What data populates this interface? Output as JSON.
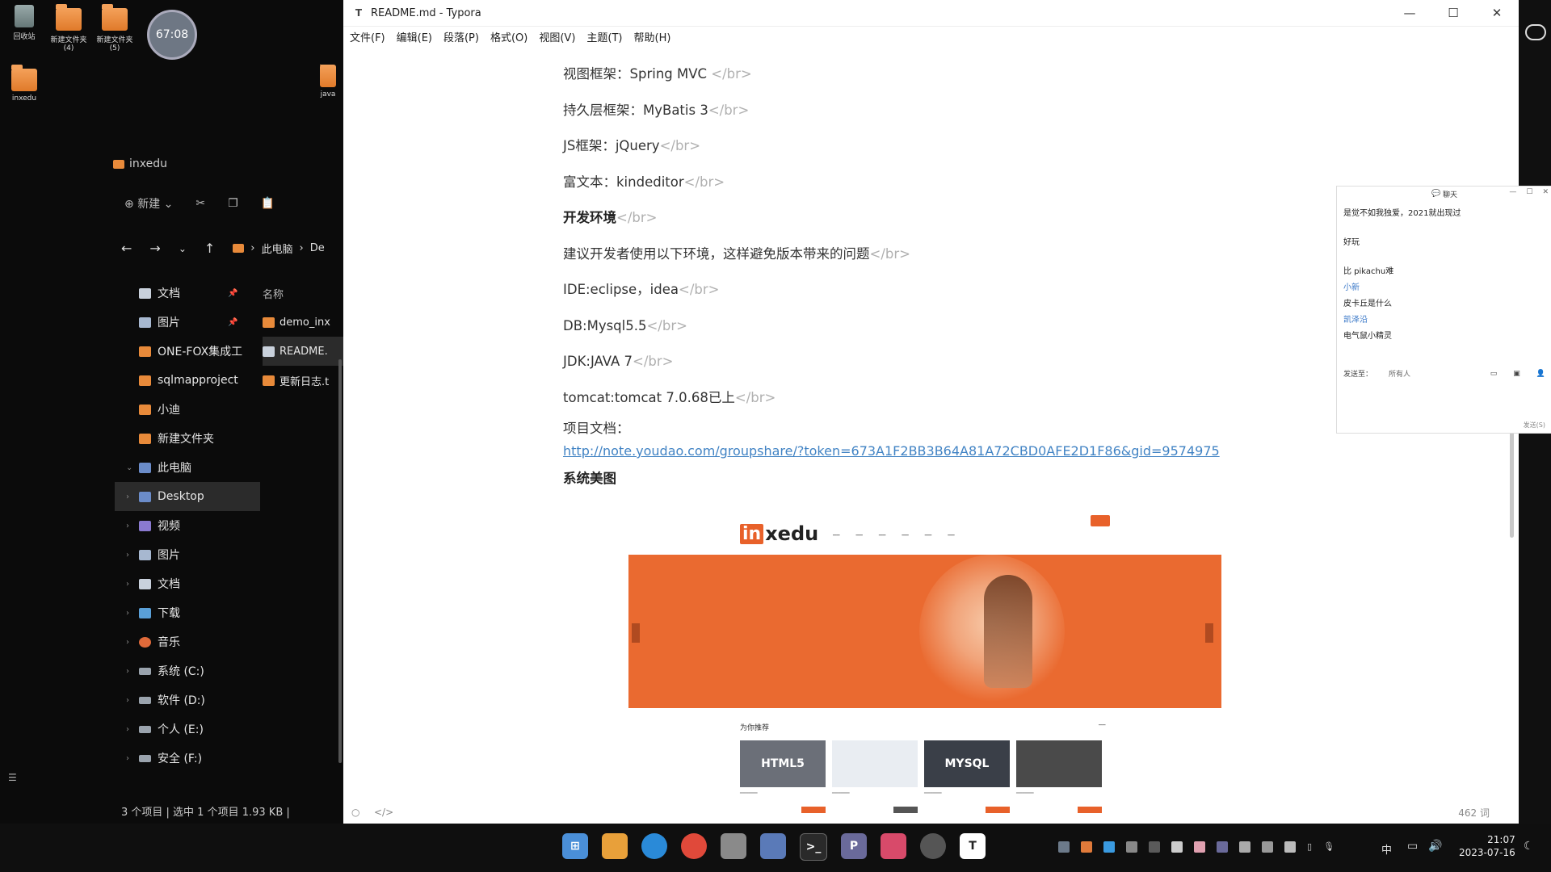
{
  "desktop": {
    "icons": [
      {
        "label": "回收站",
        "kind": "recycle"
      },
      {
        "label": "新建文件夹 (4)",
        "kind": "folder"
      },
      {
        "label": "新建文件夹 (5)",
        "kind": "folder"
      },
      {
        "label": "inxedu",
        "kind": "folder"
      },
      {
        "label": "java",
        "kind": "folder"
      }
    ],
    "timer": "67:08"
  },
  "explorer": {
    "folder_title": "inxedu",
    "toolbar": {
      "new_label": "新建"
    },
    "breadcrumb": [
      "此电脑",
      "De"
    ],
    "quick_access": [
      {
        "label": "文档",
        "icon": "doc-icon",
        "pinned": true
      },
      {
        "label": "图片",
        "icon": "picture-icon",
        "pinned": true
      },
      {
        "label": "ONE-FOX集成工",
        "icon": "folder-icon"
      },
      {
        "label": "sqlmapproject",
        "icon": "folder-icon"
      },
      {
        "label": "小迪",
        "icon": "folder-icon"
      },
      {
        "label": "新建文件夹",
        "icon": "folder-icon"
      }
    ],
    "this_pc_label": "此电脑",
    "this_pc_items": [
      {
        "label": "Desktop",
        "icon": "desktop-icon",
        "selected": true
      },
      {
        "label": "视频",
        "icon": "video-icon"
      },
      {
        "label": "图片",
        "icon": "picture-icon"
      },
      {
        "label": "文档",
        "icon": "doc-icon"
      },
      {
        "label": "下载",
        "icon": "download-icon"
      },
      {
        "label": "音乐",
        "icon": "music-icon"
      },
      {
        "label": "系统 (C:)",
        "icon": "drive-icon"
      },
      {
        "label": "软件 (D:)",
        "icon": "drive-icon"
      },
      {
        "label": "个人 (E:)",
        "icon": "drive-icon"
      },
      {
        "label": "安全 (F:)",
        "icon": "drive-icon"
      }
    ],
    "files_header": "名称",
    "files": [
      {
        "name": "demo_inx",
        "icon": "folder-icon"
      },
      {
        "name": "README.",
        "icon": "md-file-icon",
        "selected": true
      },
      {
        "name": "更新日志.t",
        "icon": "txt-file-icon"
      }
    ],
    "status": "3 个项目  |  选中 1 个项目  1.93 KB  |"
  },
  "typora": {
    "title": "README.md - Typora",
    "menu": [
      "文件(F)",
      "编辑(E)",
      "段落(P)",
      "格式(O)",
      "视图(V)",
      "主题(T)",
      "帮助(H)"
    ],
    "lines": [
      {
        "text": "视图框架：Spring MVC ",
        "tag": "</br>",
        "bold": false
      },
      {
        "text": "持久层框架：MyBatis 3",
        "tag": "</br>",
        "bold": false
      },
      {
        "text": "JS框架：jQuery",
        "tag": "</br>",
        "bold": false
      },
      {
        "text": "富文本：kindeditor",
        "tag": "</br>",
        "bold": false
      },
      {
        "text": "开发环境",
        "tag": "</br>",
        "bold": true
      },
      {
        "text": "建议开发者使用以下环境，这样避免版本带来的问题",
        "tag": "</br>",
        "bold": false
      },
      {
        "text": "IDE:eclipse，idea",
        "tag": "</br>",
        "bold": false
      },
      {
        "text": "DB:Mysql5.5",
        "tag": "</br>",
        "bold": false
      },
      {
        "text": "JDK:JAVA 7",
        "tag": "</br>",
        "bold": false
      },
      {
        "text": "tomcat:tomcat 7.0.68已上",
        "tag": "</br>",
        "bold": false
      }
    ],
    "doc_label": "项目文档：",
    "doc_link": "http://note.youdao.com/groupshare/?token=673A1F2BB3B64A81A72CBD0AFE2D1F86&gid=9574975",
    "gallery_heading": "系统美图",
    "word_count": "462 词",
    "screenshot": {
      "logo_in": "in",
      "logo_rest": "xedu",
      "rec_title": "为你推荐",
      "cards": [
        {
          "label": "HTML5",
          "color": "#6b6f78"
        },
        {
          "label": "",
          "color": "#e9edf2"
        },
        {
          "label": "MYSQL",
          "color": "#3a3f48"
        },
        {
          "label": "",
          "color": "#4a4a4a"
        }
      ]
    }
  },
  "chat": {
    "title": "聊天",
    "messages": [
      {
        "text": "是觉不如我独爱，2021就出现过",
        "blue": false
      },
      {
        "text": "好玩",
        "blue": false
      },
      {
        "text": "比 pikachu难",
        "blue": false
      },
      {
        "text": "小新",
        "blue": true
      },
      {
        "text": "皮卡丘是什么",
        "blue": false
      },
      {
        "text": "凯泽沿",
        "blue": true
      },
      {
        "text": "电气鼠小精灵",
        "blue": false
      }
    ],
    "send_to_label": "发送至：",
    "send_to_value": "所有人",
    "send_button": "发送(S)"
  },
  "taskbar": {
    "apps": [
      {
        "name": "start-icon",
        "glyph": "",
        "color": "#4a8fd8"
      },
      {
        "name": "file-explorer-icon",
        "glyph": "",
        "color": "#e8a03a"
      },
      {
        "name": "edge-icon",
        "glyph": "",
        "color": "#2a8ad8"
      },
      {
        "name": "chrome-icon",
        "glyph": "",
        "color": "#e0493a"
      },
      {
        "name": "tool-icon",
        "glyph": "",
        "color": "#8a8a8a"
      },
      {
        "name": "photos-icon",
        "glyph": "",
        "color": "#5a7ab8"
      },
      {
        "name": "terminal-icon",
        "glyph": "",
        "color": "#2a2a2a"
      },
      {
        "name": "p-app-icon",
        "glyph": "P",
        "color": "#6a6a9a"
      },
      {
        "name": "idea-icon",
        "glyph": "",
        "color": "#d84a6a"
      },
      {
        "name": "burp-icon",
        "glyph": "",
        "color": "#555"
      },
      {
        "name": "typora-icon",
        "glyph": "T",
        "color": "#333"
      }
    ],
    "ime": "中",
    "time": "21:07",
    "date": "2023-07-16"
  }
}
